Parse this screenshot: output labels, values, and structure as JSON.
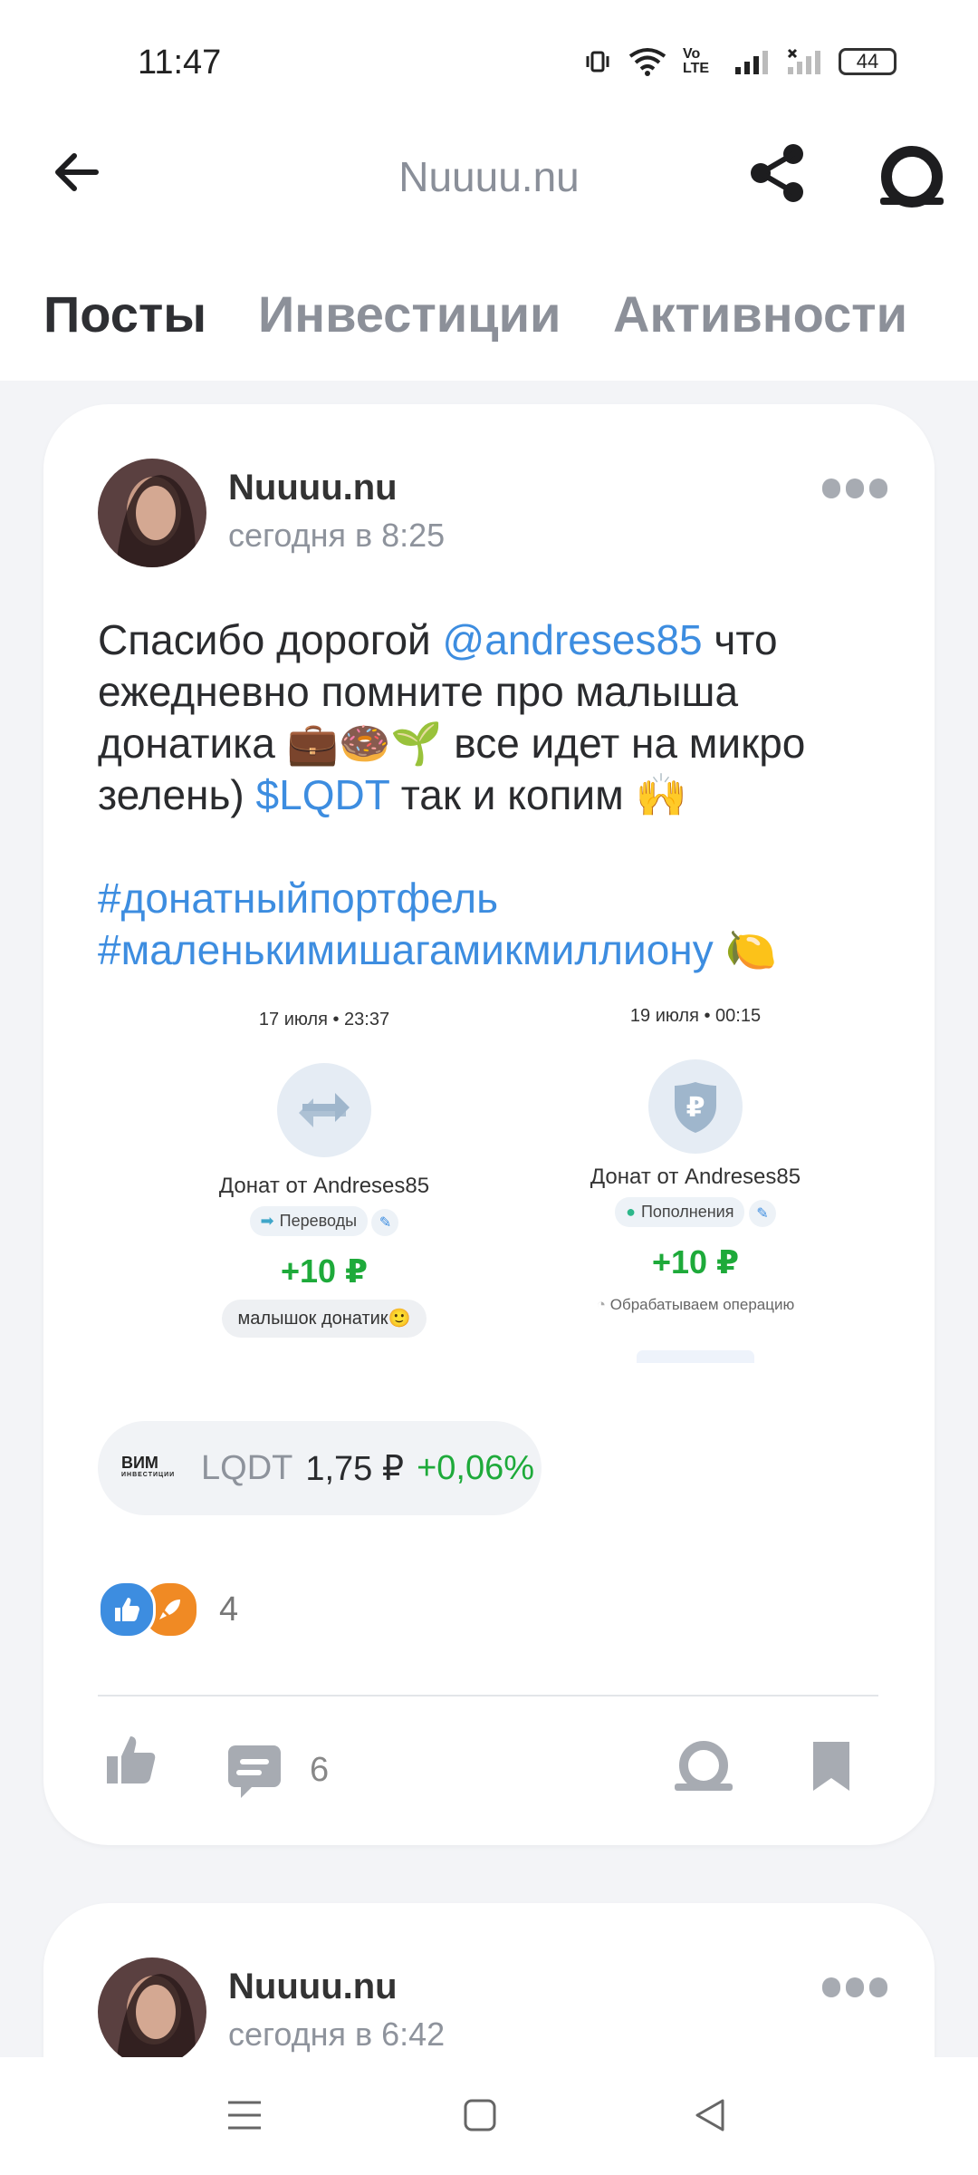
{
  "status": {
    "time": "11:47",
    "battery": "44",
    "network_label": "Vo LTE"
  },
  "header": {
    "title": "Nuuuu.nu"
  },
  "tabs": [
    {
      "label": "Посты",
      "active": true
    },
    {
      "label": "Инвестиции",
      "active": false
    },
    {
      "label": "Активности",
      "active": false
    }
  ],
  "post1": {
    "author": "Nuuuu.nu",
    "time": "сегодня в 8:25",
    "text_1": "Спасибо дорогой ",
    "mention": "@andreses85",
    "text_2": " что ежедневно помните про малыша донатика 💼🍩🌱 все идет на микро зелень) ",
    "ticker_link": "$LQDT",
    "text_3": " так и копим 🙌",
    "hashtag_1": "#донатныйпортфель",
    "hashtag_2": "#маленькимишагамикмиллиону",
    "hashtag_2_emoji": "🍋",
    "image": {
      "left": {
        "datetime": "17 июля • 23:37",
        "title": "Донат от Andreses85",
        "category": "Переводы",
        "amount": "+10 ₽",
        "message": "малышок донатик🙂"
      },
      "right": {
        "datetime": "19 июля • 00:15",
        "title": "Донат от Andreses85",
        "category": "Пополнения",
        "amount": "+10 ₽",
        "status": "Обрабатываем операцию"
      }
    },
    "ticker": {
      "logo_line1": "ВИМ",
      "logo_line2": "ИНВЕСТИЦИИ",
      "symbol": "LQDT",
      "price": "1,75 ₽",
      "change": "+0,06%",
      "change_color": "#1eaa3a"
    },
    "reactions_count": "4",
    "comments_count": "6"
  },
  "post2": {
    "author": "Nuuuu.nu",
    "time": "сегодня в 6:42"
  },
  "colors": {
    "link": "#3d8de0",
    "positive": "#1eaa3a"
  }
}
